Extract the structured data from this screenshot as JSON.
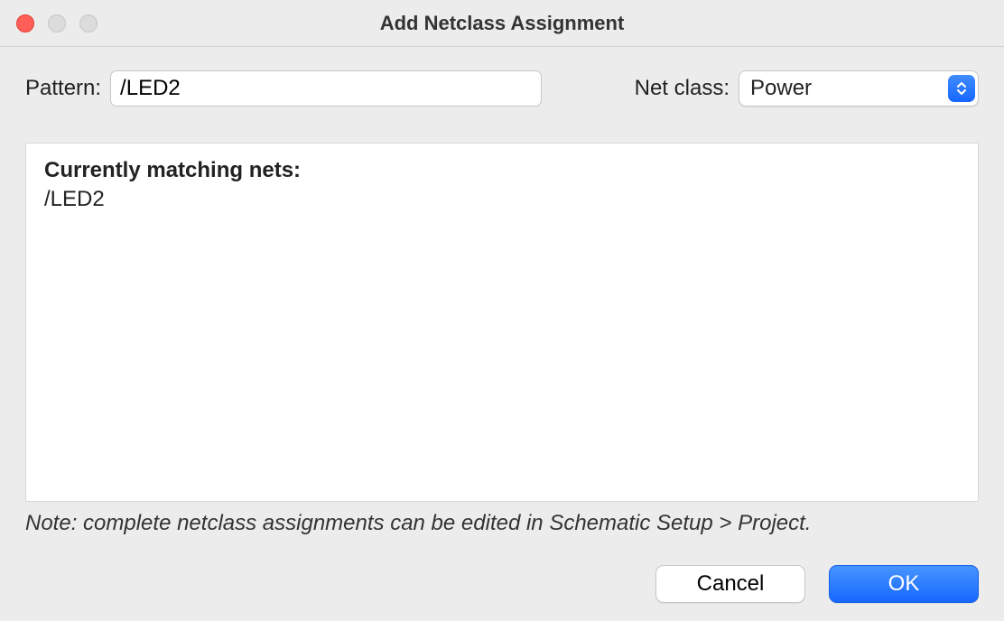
{
  "window": {
    "title": "Add Netclass Assignment"
  },
  "form": {
    "pattern_label": "Pattern:",
    "pattern_value": "/LED2",
    "netclass_label": "Net class:",
    "netclass_selected": "Power"
  },
  "matching": {
    "heading": "Currently matching nets:",
    "items": [
      "/LED2"
    ]
  },
  "note": "Note: complete netclass assignments can be edited in Schematic Setup > Project.",
  "buttons": {
    "cancel": "Cancel",
    "ok": "OK"
  }
}
